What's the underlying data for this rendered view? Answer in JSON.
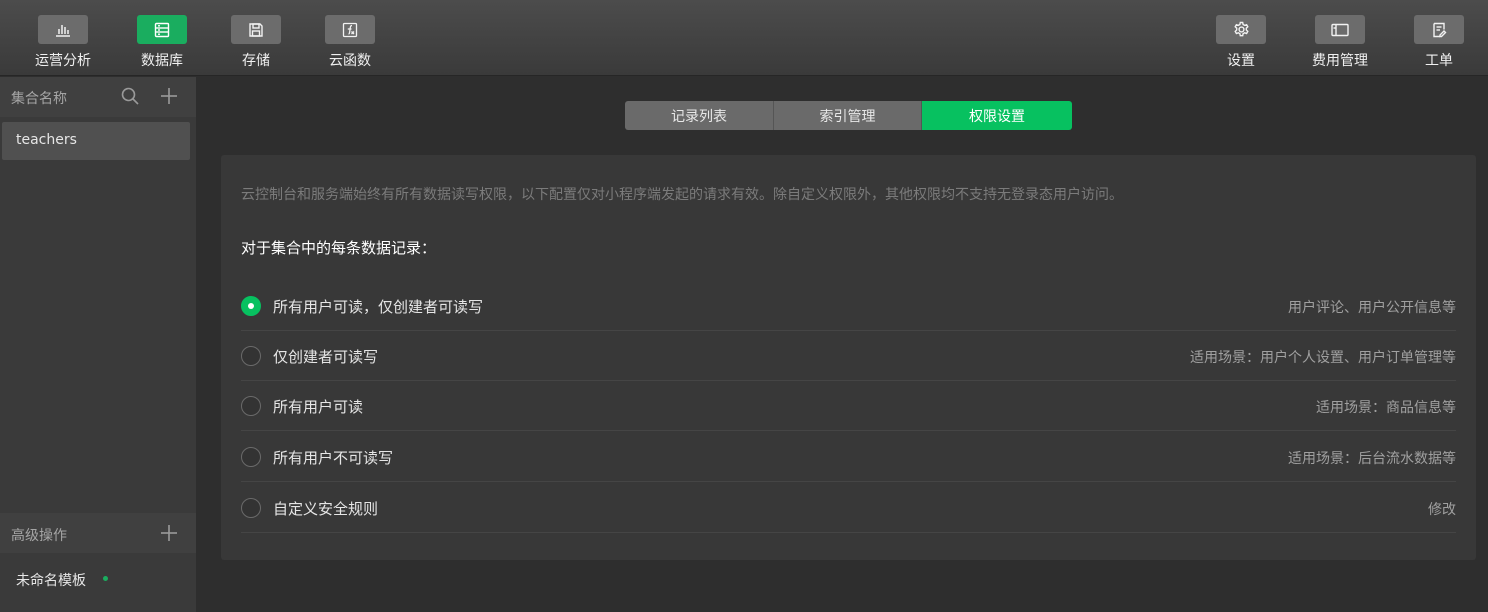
{
  "toolbar": {
    "left": [
      {
        "label": "运营分析",
        "icon": "bar-chart-icon"
      },
      {
        "label": "数据库",
        "icon": "database-icon"
      },
      {
        "label": "存储",
        "icon": "floppy-disk-icon"
      },
      {
        "label": "云函数",
        "icon": "function-icon"
      }
    ],
    "right": [
      {
        "label": "设置",
        "icon": "gear-icon"
      },
      {
        "label": "费用管理",
        "icon": "card-icon"
      },
      {
        "label": "工单",
        "icon": "ticket-icon"
      }
    ],
    "active": "数据库",
    "accent_color": "#07c160"
  },
  "sidebar": {
    "collections_title": "集合名称",
    "collections": [
      "teachers"
    ],
    "advanced_title": "高级操作",
    "templates": [
      "未命名模板"
    ]
  },
  "tabs": [
    {
      "label": "记录列表"
    },
    {
      "label": "索引管理"
    },
    {
      "label": "权限设置",
      "active": true
    }
  ],
  "permissions": {
    "notice": "云控制台和服务端始终有所有数据读写权限，以下配置仅对小程序端发起的请求有效。除自定义权限外，其他权限均不支持无登录态用户访问。",
    "section_title": "对于集合中的每条数据记录：",
    "options": [
      {
        "label": "所有用户可读，仅创建者可读写",
        "hint": "用户评论、用户公开信息等",
        "selected": true
      },
      {
        "label": "仅创建者可读写",
        "hint": "适用场景：用户个人设置、用户订单管理等",
        "selected": false
      },
      {
        "label": "所有用户可读",
        "hint": "适用场景：商品信息等",
        "selected": false
      },
      {
        "label": "所有用户不可读写",
        "hint": "适用场景：后台流水数据等",
        "selected": false
      },
      {
        "label": "自定义安全规则",
        "hint": "修改",
        "selected": false
      }
    ]
  }
}
